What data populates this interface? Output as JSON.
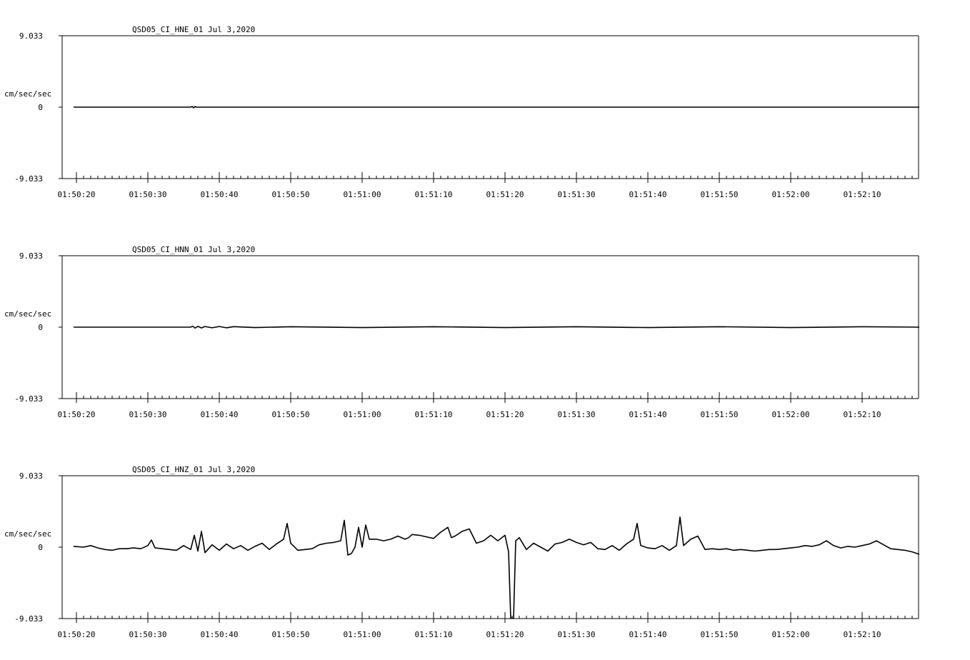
{
  "chart_data": [
    {
      "type": "line",
      "title": "QSD05_CI_HNE_01  Jul 3,2020",
      "ylabel": "cm/sec/sec",
      "ylim": [
        -9.033,
        9.033
      ],
      "y_tick_labels": [
        "9.033",
        "0",
        "-9.033"
      ],
      "x_tick_labels": [
        "01:50:20",
        "01:50:30",
        "01:50:40",
        "01:50:50",
        "01:51:00",
        "01:51:10",
        "01:51:20",
        "01:51:30",
        "01:51:40",
        "01:51:50",
        "01:52:00",
        "01:52:10"
      ],
      "x_start_seconds_after_label_0": -0.4,
      "x_end_seconds_after_label_0": 118.0,
      "series": [
        {
          "values": [
            [
              -0.4,
              0
            ],
            [
              16.0,
              0
            ],
            [
              16.2,
              0.08
            ],
            [
              16.4,
              -0.08
            ],
            [
              16.6,
              0.08
            ],
            [
              16.8,
              0
            ],
            [
              118.0,
              0
            ]
          ]
        }
      ]
    },
    {
      "type": "line",
      "title": "QSD05_CI_HNN_01  Jul 3,2020",
      "ylabel": "cm/sec/sec",
      "ylim": [
        -9.033,
        9.033
      ],
      "y_tick_labels": [
        "9.033",
        "0",
        "-9.033"
      ],
      "x_tick_labels": [
        "01:50:20",
        "01:50:30",
        "01:50:40",
        "01:50:50",
        "01:51:00",
        "01:51:10",
        "01:51:20",
        "01:51:30",
        "01:51:40",
        "01:51:50",
        "01:52:00",
        "01:52:10"
      ],
      "x_start_seconds_after_label_0": -0.4,
      "x_end_seconds_after_label_0": 118.0,
      "series": [
        {
          "values": [
            [
              -0.4,
              0
            ],
            [
              16.0,
              0
            ],
            [
              16.3,
              0.12
            ],
            [
              16.6,
              -0.12
            ],
            [
              17.0,
              0.1
            ],
            [
              17.5,
              -0.1
            ],
            [
              18.0,
              0.08
            ],
            [
              19.0,
              -0.08
            ],
            [
              20.0,
              0.08
            ],
            [
              21.0,
              -0.08
            ],
            [
              22.0,
              0.06
            ],
            [
              25.0,
              -0.05
            ],
            [
              30.0,
              0.05
            ],
            [
              40.0,
              -0.05
            ],
            [
              50.0,
              0.05
            ],
            [
              60.0,
              -0.05
            ],
            [
              70.0,
              0.05
            ],
            [
              80.0,
              -0.05
            ],
            [
              90.0,
              0.05
            ],
            [
              100.0,
              -0.05
            ],
            [
              110.0,
              0.05
            ],
            [
              118.0,
              0
            ]
          ]
        }
      ]
    },
    {
      "type": "line",
      "title": "QSD05_CI_HNZ_01  Jul 3,2020",
      "ylabel": "cm/sec/sec",
      "ylim": [
        -9.033,
        9.033
      ],
      "y_tick_labels": [
        "9.033",
        "0",
        "-9.033"
      ],
      "x_tick_labels": [
        "01:50:20",
        "01:50:30",
        "01:50:40",
        "01:50:50",
        "01:51:00",
        "01:51:10",
        "01:51:20",
        "01:51:30",
        "01:51:40",
        "01:51:50",
        "01:52:00",
        "01:52:10"
      ],
      "x_start_seconds_after_label_0": -0.4,
      "x_end_seconds_after_label_0": 118.0,
      "series": [
        {
          "values": [
            [
              -0.4,
              0.1
            ],
            [
              1.0,
              0.0
            ],
            [
              2.0,
              0.2
            ],
            [
              3.0,
              -0.1
            ],
            [
              4.0,
              -0.3
            ],
            [
              5.0,
              -0.4
            ],
            [
              6.0,
              -0.2
            ],
            [
              7.0,
              -0.2
            ],
            [
              8.0,
              -0.1
            ],
            [
              9.0,
              -0.2
            ],
            [
              10.0,
              0.2
            ],
            [
              10.5,
              0.9
            ],
            [
              11.0,
              -0.1
            ],
            [
              12.0,
              -0.2
            ],
            [
              13.0,
              -0.3
            ],
            [
              14.0,
              -0.4
            ],
            [
              15.0,
              0.2
            ],
            [
              16.0,
              -0.3
            ],
            [
              16.5,
              1.5
            ],
            [
              17.0,
              -0.5
            ],
            [
              17.5,
              2.0
            ],
            [
              18.0,
              -0.7
            ],
            [
              19.0,
              0.3
            ],
            [
              20.0,
              -0.4
            ],
            [
              21.0,
              0.4
            ],
            [
              22.0,
              -0.2
            ],
            [
              23.0,
              0.2
            ],
            [
              24.0,
              -0.4
            ],
            [
              25.0,
              0.1
            ],
            [
              26.0,
              0.5
            ],
            [
              27.0,
              -0.3
            ],
            [
              28.0,
              0.4
            ],
            [
              29.0,
              1.0
            ],
            [
              29.5,
              3.0
            ],
            [
              30.0,
              0.5
            ],
            [
              31.0,
              -0.4
            ],
            [
              32.0,
              -0.3
            ],
            [
              33.0,
              -0.2
            ],
            [
              34.0,
              0.3
            ],
            [
              35.0,
              0.5
            ],
            [
              36.0,
              0.6
            ],
            [
              37.0,
              0.8
            ],
            [
              37.5,
              3.4
            ],
            [
              38.0,
              -1.0
            ],
            [
              38.5,
              -0.8
            ],
            [
              39.0,
              0.0
            ],
            [
              39.5,
              2.5
            ],
            [
              40.0,
              0.0
            ],
            [
              40.5,
              2.8
            ],
            [
              41.0,
              1.0
            ],
            [
              42.0,
              1.0
            ],
            [
              43.0,
              0.8
            ],
            [
              44.0,
              1.0
            ],
            [
              45.0,
              1.4
            ],
            [
              46.0,
              1.0
            ],
            [
              46.5,
              1.2
            ],
            [
              47.0,
              1.6
            ],
            [
              48.0,
              1.5
            ],
            [
              49.0,
              1.3
            ],
            [
              50.0,
              1.1
            ],
            [
              51.0,
              1.9
            ],
            [
              52.0,
              2.5
            ],
            [
              52.5,
              1.2
            ],
            [
              53.0,
              1.4
            ],
            [
              54.0,
              2.0
            ],
            [
              55.0,
              2.3
            ],
            [
              56.0,
              0.5
            ],
            [
              57.0,
              0.8
            ],
            [
              58.0,
              1.5
            ],
            [
              59.0,
              0.8
            ],
            [
              60.0,
              1.5
            ],
            [
              60.5,
              -0.6
            ],
            [
              60.8,
              -9.0
            ],
            [
              61.2,
              -9.0
            ],
            [
              61.5,
              0.8
            ],
            [
              62.0,
              1.2
            ],
            [
              63.0,
              -0.3
            ],
            [
              64.0,
              0.5
            ],
            [
              65.0,
              0.0
            ],
            [
              66.0,
              -0.5
            ],
            [
              67.0,
              0.4
            ],
            [
              68.0,
              0.6
            ],
            [
              69.0,
              1.0
            ],
            [
              70.0,
              0.6
            ],
            [
              71.0,
              0.3
            ],
            [
              72.0,
              0.6
            ],
            [
              73.0,
              -0.2
            ],
            [
              74.0,
              -0.3
            ],
            [
              75.0,
              0.2
            ],
            [
              76.0,
              -0.4
            ],
            [
              77.0,
              0.4
            ],
            [
              78.0,
              1.0
            ],
            [
              78.5,
              3.0
            ],
            [
              79.0,
              0.2
            ],
            [
              80.0,
              -0.1
            ],
            [
              81.0,
              -0.2
            ],
            [
              82.0,
              0.2
            ],
            [
              83.0,
              -0.4
            ],
            [
              84.0,
              0.2
            ],
            [
              84.5,
              3.8
            ],
            [
              85.0,
              0.2
            ],
            [
              86.0,
              1.0
            ],
            [
              87.0,
              1.4
            ],
            [
              88.0,
              -0.3
            ],
            [
              89.0,
              -0.2
            ],
            [
              90.0,
              -0.3
            ],
            [
              91.0,
              -0.2
            ],
            [
              92.0,
              -0.4
            ],
            [
              93.0,
              -0.3
            ],
            [
              94.0,
              -0.4
            ],
            [
              95.0,
              -0.5
            ],
            [
              96.0,
              -0.4
            ],
            [
              97.0,
              -0.3
            ],
            [
              98.0,
              -0.3
            ],
            [
              99.0,
              -0.2
            ],
            [
              100.0,
              -0.1
            ],
            [
              101.0,
              0.0
            ],
            [
              102.0,
              0.2
            ],
            [
              103.0,
              0.1
            ],
            [
              104.0,
              0.3
            ],
            [
              105.0,
              0.8
            ],
            [
              106.0,
              0.2
            ],
            [
              107.0,
              -0.1
            ],
            [
              108.0,
              0.1
            ],
            [
              109.0,
              0.0
            ],
            [
              110.0,
              0.2
            ],
            [
              111.0,
              0.4
            ],
            [
              112.0,
              0.8
            ],
            [
              113.0,
              0.3
            ],
            [
              114.0,
              -0.2
            ],
            [
              115.0,
              -0.3
            ],
            [
              116.0,
              -0.4
            ],
            [
              117.0,
              -0.6
            ],
            [
              118.0,
              -0.9
            ]
          ]
        }
      ]
    }
  ]
}
